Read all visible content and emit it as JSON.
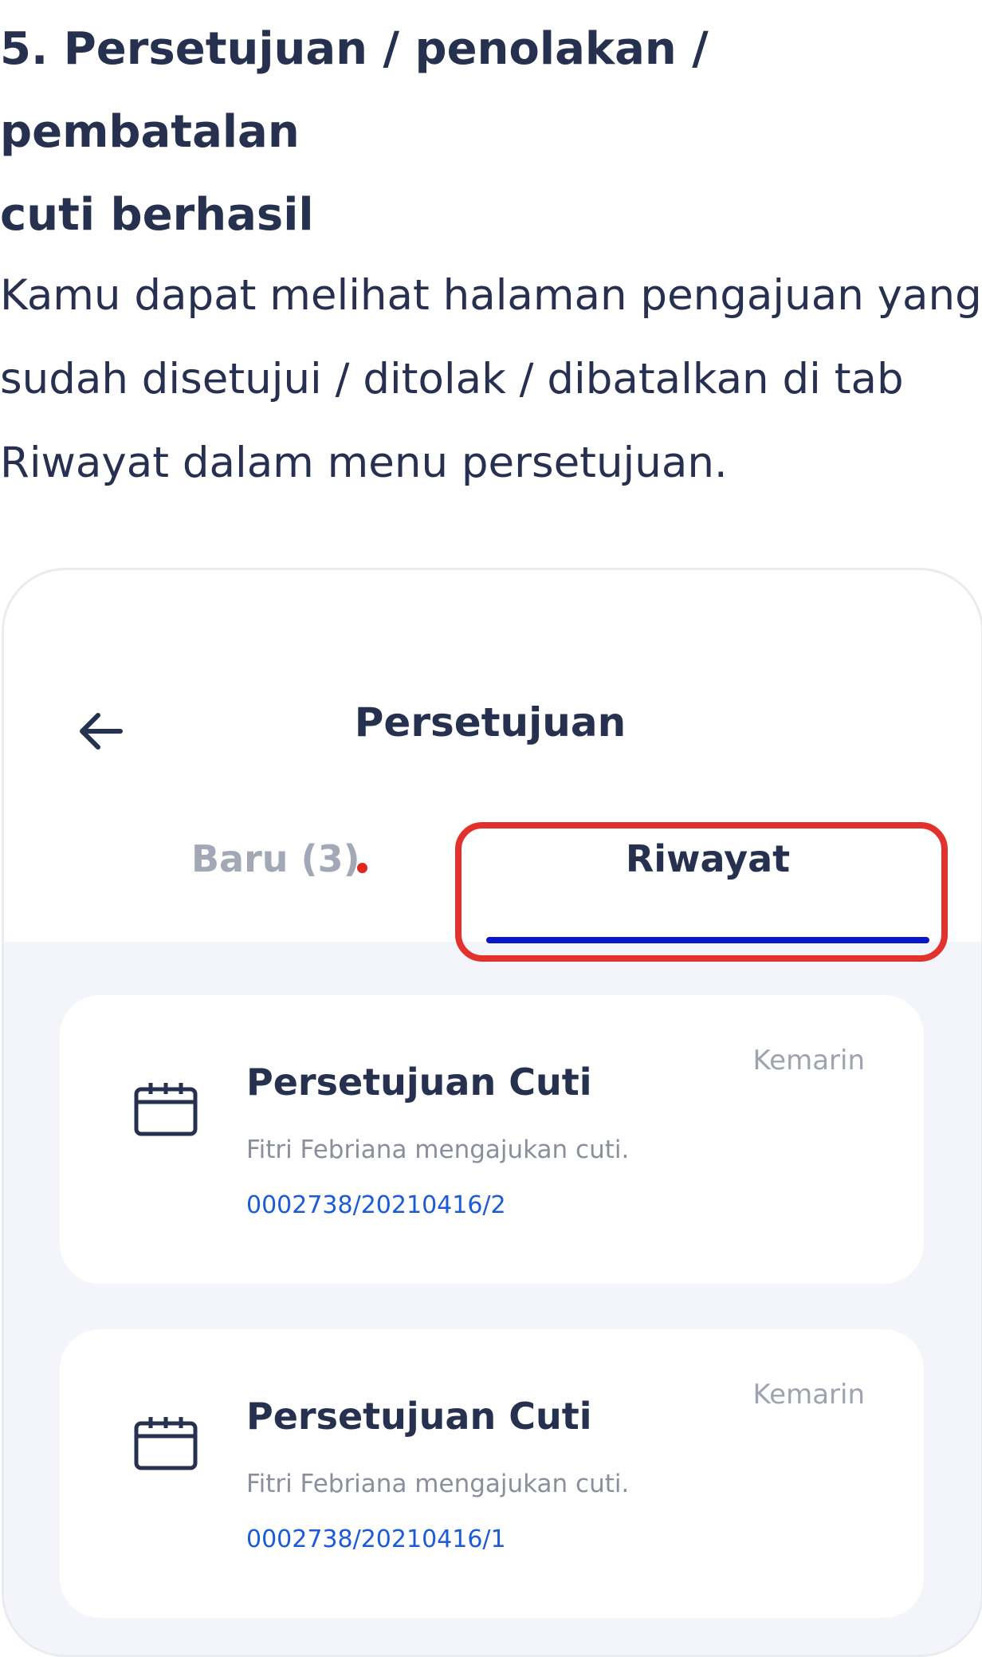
{
  "article": {
    "heading_line1": "5.  Persetujuan / penolakan / pembatalan",
    "heading_line2": "cuti berhasil",
    "intro_line1": "Kamu dapat melihat halaman pengajuan yang",
    "intro_line2": "sudah disetujui / ditolak / dibatalkan di tab",
    "intro_line3": "Riwayat dalam menu persetujuan."
  },
  "app": {
    "back_icon": "arrow-left-icon",
    "title": "Persetujuan",
    "tabs": [
      {
        "label": "Baru (3)",
        "active": false,
        "has_notification_dot": true
      },
      {
        "label": "Riwayat",
        "active": true
      }
    ],
    "cards": [
      {
        "icon": "calendar-icon",
        "title": "Persetujuan Cuti",
        "time": "Kemarin",
        "description": "Fitri Febriana mengajukan cuti.",
        "reference": "0002738/20210416/2"
      },
      {
        "icon": "calendar-icon",
        "title": "Persetujuan Cuti",
        "time": "Kemarin",
        "description": "Fitri Febriana mengajukan cuti.",
        "reference": "0002738/20210416/1"
      }
    ]
  },
  "colors": {
    "text_dark": "#26304f",
    "tab_inactive": "#a3a8b6",
    "tab_underline": "#0a17c8",
    "notification_dot": "#e0261d",
    "highlight": "#e3312b",
    "reference_link": "#1b5bd8",
    "body_background": "#f4f5fa"
  }
}
